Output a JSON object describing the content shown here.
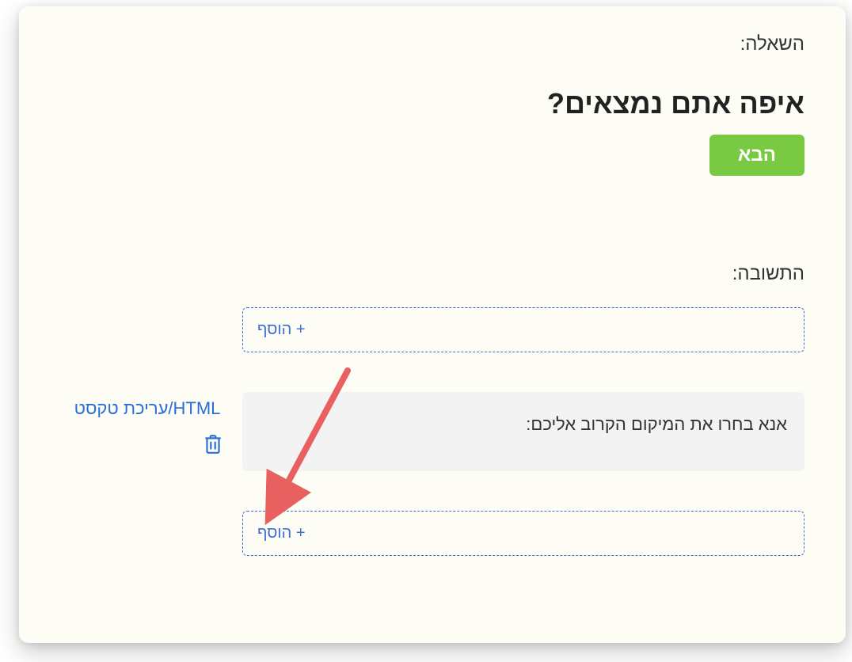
{
  "question": {
    "label": "השאלה:",
    "text": "איפה אתם נמצאים?",
    "next_button": "הבא"
  },
  "answer": {
    "label": "התשובה:",
    "add_label": "הוסף +",
    "content": "אנא בחרו את המיקום הקרוב אליכם:",
    "edit_link": "עריכת טקסט/HTML"
  }
}
